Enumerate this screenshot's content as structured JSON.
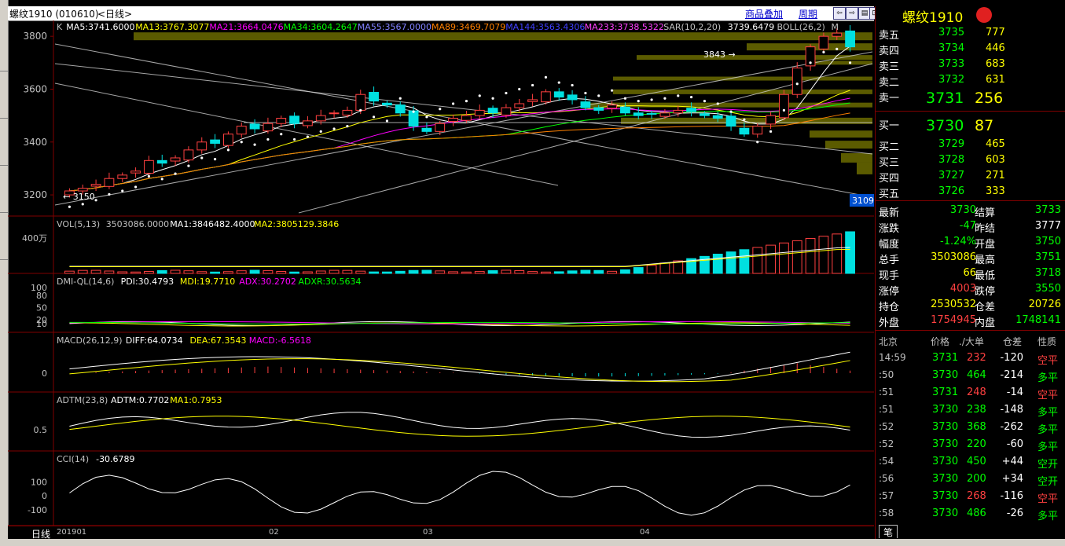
{
  "window": {
    "title": "螺纹1910 (010610)",
    "period_suffix": "<日线>",
    "links": [
      "商品叠加",
      "周期"
    ],
    "nav": [
      "⇦",
      "⇨",
      "▤",
      "⊡"
    ]
  },
  "colors": {
    "up": "#ff4040",
    "down": "#00e0e0",
    "bg": "#000000",
    "panel_border": "#800000",
    "yellow": "#ffff00",
    "green": "#00ff00",
    "white": "#ffffff",
    "magenta": "#ff00ff",
    "cyan": "#00ffff"
  },
  "main": {
    "indicators": [
      {
        "text": "K",
        "color": "#c0c0c0"
      },
      {
        "text": "MA5:3741.6000",
        "color": "#ffffff"
      },
      {
        "text": "MA13:3767.3077",
        "color": "#ffff00"
      },
      {
        "text": "MA21:3664.0476",
        "color": "#ff00ff"
      },
      {
        "text": "MA34:3604.2647",
        "color": "#00ff00"
      },
      {
        "text": "MA55:3567.0000",
        "color": "#8080ff"
      },
      {
        "text": "MA89:3469.7079",
        "color": "#ff8000"
      },
      {
        "text": "MA144:3563.4306",
        "color": "#4040ff"
      },
      {
        "text": "MA233:3738.5322",
        "color": "#ff40ff"
      },
      {
        "text": "SAR(10,2,20)",
        "color": "#c0c0c0"
      },
      {
        "text": "3739.6479",
        "color": "#ffffff"
      },
      {
        "text": "BOLL(26,2)",
        "color": "#c0c0c0"
      },
      {
        "text": "M",
        "color": "#c0c0c0"
      }
    ],
    "yticks": [
      "3800",
      "3600",
      "3400",
      "3200"
    ],
    "high_label": "3843",
    "low_label": "3150",
    "right_tag": "3109"
  },
  "vol": {
    "indicators": [
      {
        "text": "VOL(5,13)",
        "color": "#c0c0c0"
      },
      {
        "text": "3503086.0000",
        "color": "#c0c0c0"
      },
      {
        "text": "MA1:3846482.4000",
        "color": "#ffffff"
      },
      {
        "text": "MA2:3805129.3846",
        "color": "#ffff00"
      }
    ],
    "ytick": "400万"
  },
  "dmi": {
    "indicators": [
      {
        "text": "DMI-QL(14,6)",
        "color": "#c0c0c0"
      },
      {
        "text": "PDI:30.4793",
        "color": "#ffffff"
      },
      {
        "text": "MDI:19.7710",
        "color": "#ffff00"
      },
      {
        "text": "ADX:30.2702",
        "color": "#ff00ff"
      },
      {
        "text": "ADXR:30.5634",
        "color": "#00ff00"
      }
    ],
    "yticks": [
      "100",
      "80",
      "50",
      "20",
      "10"
    ]
  },
  "macd": {
    "indicators": [
      {
        "text": "MACD(26,12,9)",
        "color": "#c0c0c0"
      },
      {
        "text": "DIFF:64.0734",
        "color": "#ffffff"
      },
      {
        "text": "DEA:67.3543",
        "color": "#ffff00"
      },
      {
        "text": "MACD:-6.5618",
        "color": "#ff00ff"
      }
    ],
    "ytick": "0"
  },
  "adtm": {
    "indicators": [
      {
        "text": "ADTM(23,8)",
        "color": "#c0c0c0"
      },
      {
        "text": "ADTM:0.7702",
        "color": "#ffffff"
      },
      {
        "text": "MA1:0.7953",
        "color": "#ffff00"
      }
    ],
    "ytick": "0.5"
  },
  "cci": {
    "indicators": [
      {
        "text": "CCI(14)",
        "color": "#c0c0c0"
      },
      {
        "text": "-30.6789",
        "color": "#ffffff"
      }
    ],
    "yticks": [
      "100",
      "0",
      "-100"
    ]
  },
  "xaxis": {
    "label": "日线",
    "ticks": [
      "201901",
      "02",
      "03",
      "04"
    ]
  },
  "quote": {
    "title": "螺纹1910",
    "asks": [
      {
        "l": "卖五",
        "p": "3735",
        "v": "777"
      },
      {
        "l": "卖四",
        "p": "3734",
        "v": "446"
      },
      {
        "l": "卖三",
        "p": "3733",
        "v": "683"
      },
      {
        "l": "卖二",
        "p": "3732",
        "v": "631"
      },
      {
        "l": "卖一",
        "p": "3731",
        "v": "256"
      }
    ],
    "bids": [
      {
        "l": "买一",
        "p": "3730",
        "v": "87"
      },
      {
        "l": "买二",
        "p": "3729",
        "v": "465"
      },
      {
        "l": "买三",
        "p": "3728",
        "v": "603"
      },
      {
        "l": "买四",
        "p": "3727",
        "v": "271"
      },
      {
        "l": "买五",
        "p": "3726",
        "v": "333"
      }
    ],
    "stats": [
      {
        "l1": "最新",
        "v1": "3730",
        "c1": "#00ff00",
        "l2": "结算",
        "v2": "3733",
        "c2": "#00ff00"
      },
      {
        "l1": "涨跌",
        "v1": "-47",
        "c1": "#00ff00",
        "l2": "昨结",
        "v2": "3777",
        "c2": "#ffffff"
      },
      {
        "l1": "幅度",
        "v1": "-1.24%",
        "c1": "#00ff00",
        "l2": "开盘",
        "v2": "3750",
        "c2": "#00ff00"
      },
      {
        "l1": "总手",
        "v1": "3503086",
        "c1": "#ffff00",
        "l2": "最高",
        "v2": "3751",
        "c2": "#00ff00"
      },
      {
        "l1": "现手",
        "v1": "66",
        "c1": "#ffff00",
        "l2": "最低",
        "v2": "3718",
        "c2": "#00ff00"
      },
      {
        "l1": "涨停",
        "v1": "4003",
        "c1": "#ff4040",
        "l2": "跌停",
        "v2": "3550",
        "c2": "#00ff00"
      },
      {
        "l1": "持仓",
        "v1": "2530532",
        "c1": "#ffff00",
        "l2": "仓差",
        "v2": "20726",
        "c2": "#ffff00"
      },
      {
        "l1": "外盘",
        "v1": "1754945",
        "c1": "#ff4040",
        "l2": "内盘",
        "v2": "1748141",
        "c2": "#00ff00"
      }
    ],
    "tick_header": [
      "北京",
      "价格",
      "./大单",
      "仓差",
      "性质"
    ],
    "ticks": [
      {
        "t": "14:59",
        "p": "3731",
        "v": "232",
        "vc": "#ff4040",
        "d": "-120",
        "n": "空平",
        "nc": "#ff4040"
      },
      {
        "t": ":50",
        "p": "3730",
        "v": "464",
        "vc": "#00ff00",
        "d": "-214",
        "n": "多平",
        "nc": "#00ff00"
      },
      {
        "t": ":51",
        "p": "3731",
        "v": "248",
        "vc": "#ff4040",
        "d": "-14",
        "n": "空平",
        "nc": "#ff4040"
      },
      {
        "t": ":51",
        "p": "3730",
        "v": "238",
        "vc": "#00ff00",
        "d": "-148",
        "n": "多平",
        "nc": "#00ff00"
      },
      {
        "t": ":52",
        "p": "3730",
        "v": "368",
        "vc": "#00ff00",
        "d": "-262",
        "n": "多平",
        "nc": "#00ff00"
      },
      {
        "t": ":52",
        "p": "3730",
        "v": "220",
        "vc": "#00ff00",
        "d": "-60",
        "n": "多平",
        "nc": "#00ff00"
      },
      {
        "t": ":54",
        "p": "3730",
        "v": "450",
        "vc": "#00ff00",
        "d": "+44",
        "n": "空开",
        "nc": "#00ff00"
      },
      {
        "t": ":56",
        "p": "3730",
        "v": "200",
        "vc": "#00ff00",
        "d": "+34",
        "n": "空开",
        "nc": "#00ff00"
      },
      {
        "t": ":57",
        "p": "3730",
        "v": "268",
        "vc": "#ff4040",
        "d": "-116",
        "n": "空平",
        "nc": "#ff4040"
      },
      {
        "t": ":58",
        "p": "3730",
        "v": "486",
        "vc": "#00ff00",
        "d": "-26",
        "n": "多平",
        "nc": "#00ff00"
      }
    ],
    "footer_tab": "笔"
  }
}
